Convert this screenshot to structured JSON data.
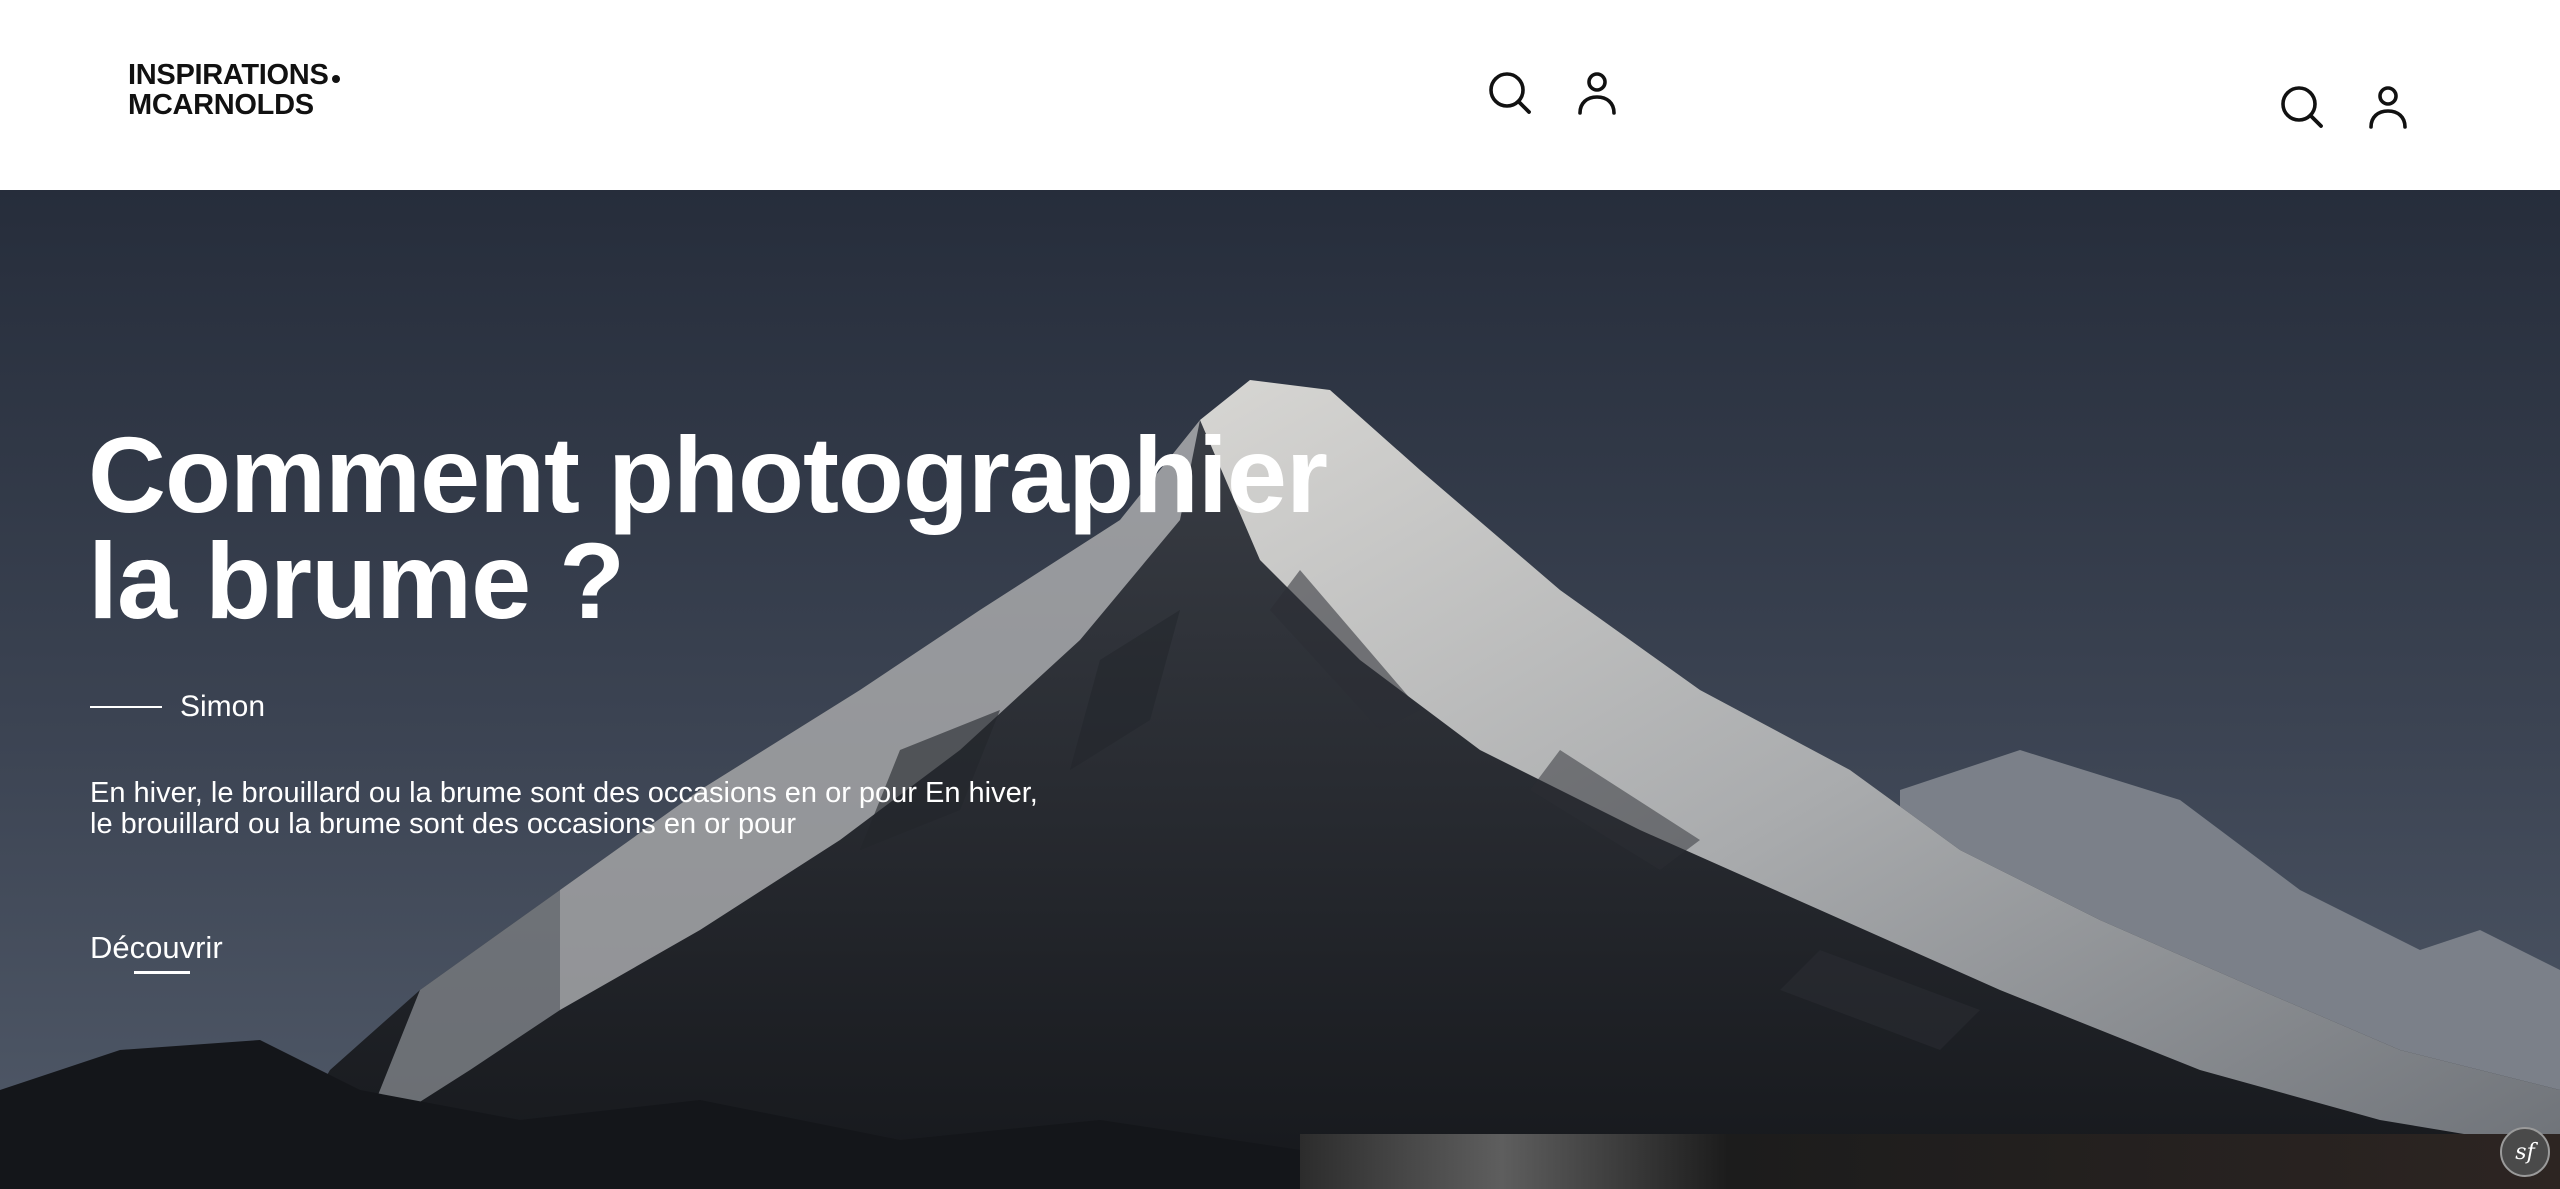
{
  "header": {
    "logo_line1": "INSPIRATIONS",
    "logo_line2": "MCARNOLDS"
  },
  "icons": {
    "search": "search-icon",
    "user": "user-icon"
  },
  "hero": {
    "title_line1": "Comment photographier",
    "title_line2": "la brume ?",
    "author": "Simon",
    "excerpt_line1": "En hiver, le brouillard ou la brume sont des occasions en or pour En hiver,",
    "excerpt_line2": "le brouillard ou la brume sont des occasions en or pour",
    "cta_label": "Découvrir"
  },
  "debug_toolbar": {
    "label": "sf"
  },
  "colors": {
    "header_bg": "#ffffff",
    "text_dark": "#111111",
    "hero_text": "#ffffff",
    "sky": "#37404f"
  }
}
